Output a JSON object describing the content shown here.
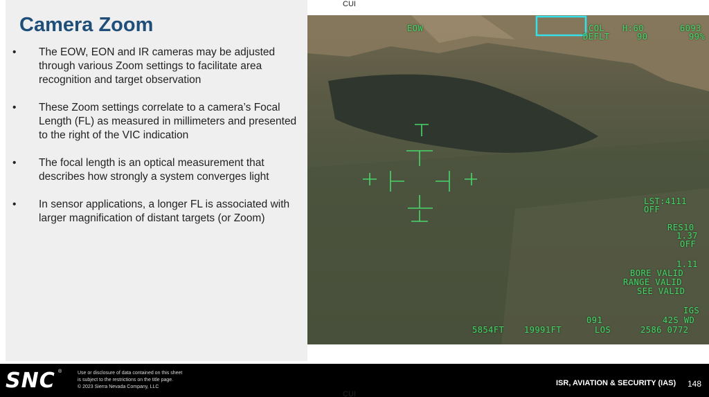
{
  "slide": {
    "title": "Camera Zoom",
    "bullet_char": "•",
    "bullets": [
      "The EOW, EON and IR cameras may be adjusted through various Zoom settings to facilitate area recognition and target observation",
      "These Zoom settings correlate to a camera’s Focal Length (FL) as measured in millimeters and presented to the right of the VIC indication",
      "The focal length is an optical measurement that describes how strongly a system converges light",
      "In sensor applications, a longer FL is associated with larger magnification of distant targets (or Zoom)"
    ]
  },
  "marking": {
    "top": "CUI",
    "bottom": "CUI"
  },
  "hud": {
    "mode": "EOW",
    "col": "COL",
    "hdg": "H:60",
    "num1": "6093",
    "defl": "DEFLT",
    "defl_val": "90",
    "pct": "99%",
    "lst_label": "LST:4111",
    "lst_state": "OFF",
    "res_label": "RES10",
    "res_val": "1.37",
    "res_state": "OFF",
    "num2": "1.11",
    "bore": "BORE VALID",
    "range": "RANGE VALID",
    "see": "SEE VALID",
    "igs": "IGS",
    "hdg2": "091",
    "wind": "42S WD",
    "alt1": "5854FT",
    "alt2": "19991FT",
    "los": "LOS",
    "coord": "2586 0772"
  },
  "footer": {
    "logo": "SNC",
    "reg": "®",
    "disclaimer": [
      "Use or disclosure of data contained on this sheet",
      "is subject to the restrictions on the title page.",
      "© 2023 Sierra Nevada Company, LLC"
    ],
    "division": "ISR, AVIATION & SECURITY (IAS)",
    "page": "148"
  },
  "colors": {
    "title": "#1f4e79",
    "hud_green": "#49d66a",
    "hud_cyan": "#37e0e8"
  }
}
